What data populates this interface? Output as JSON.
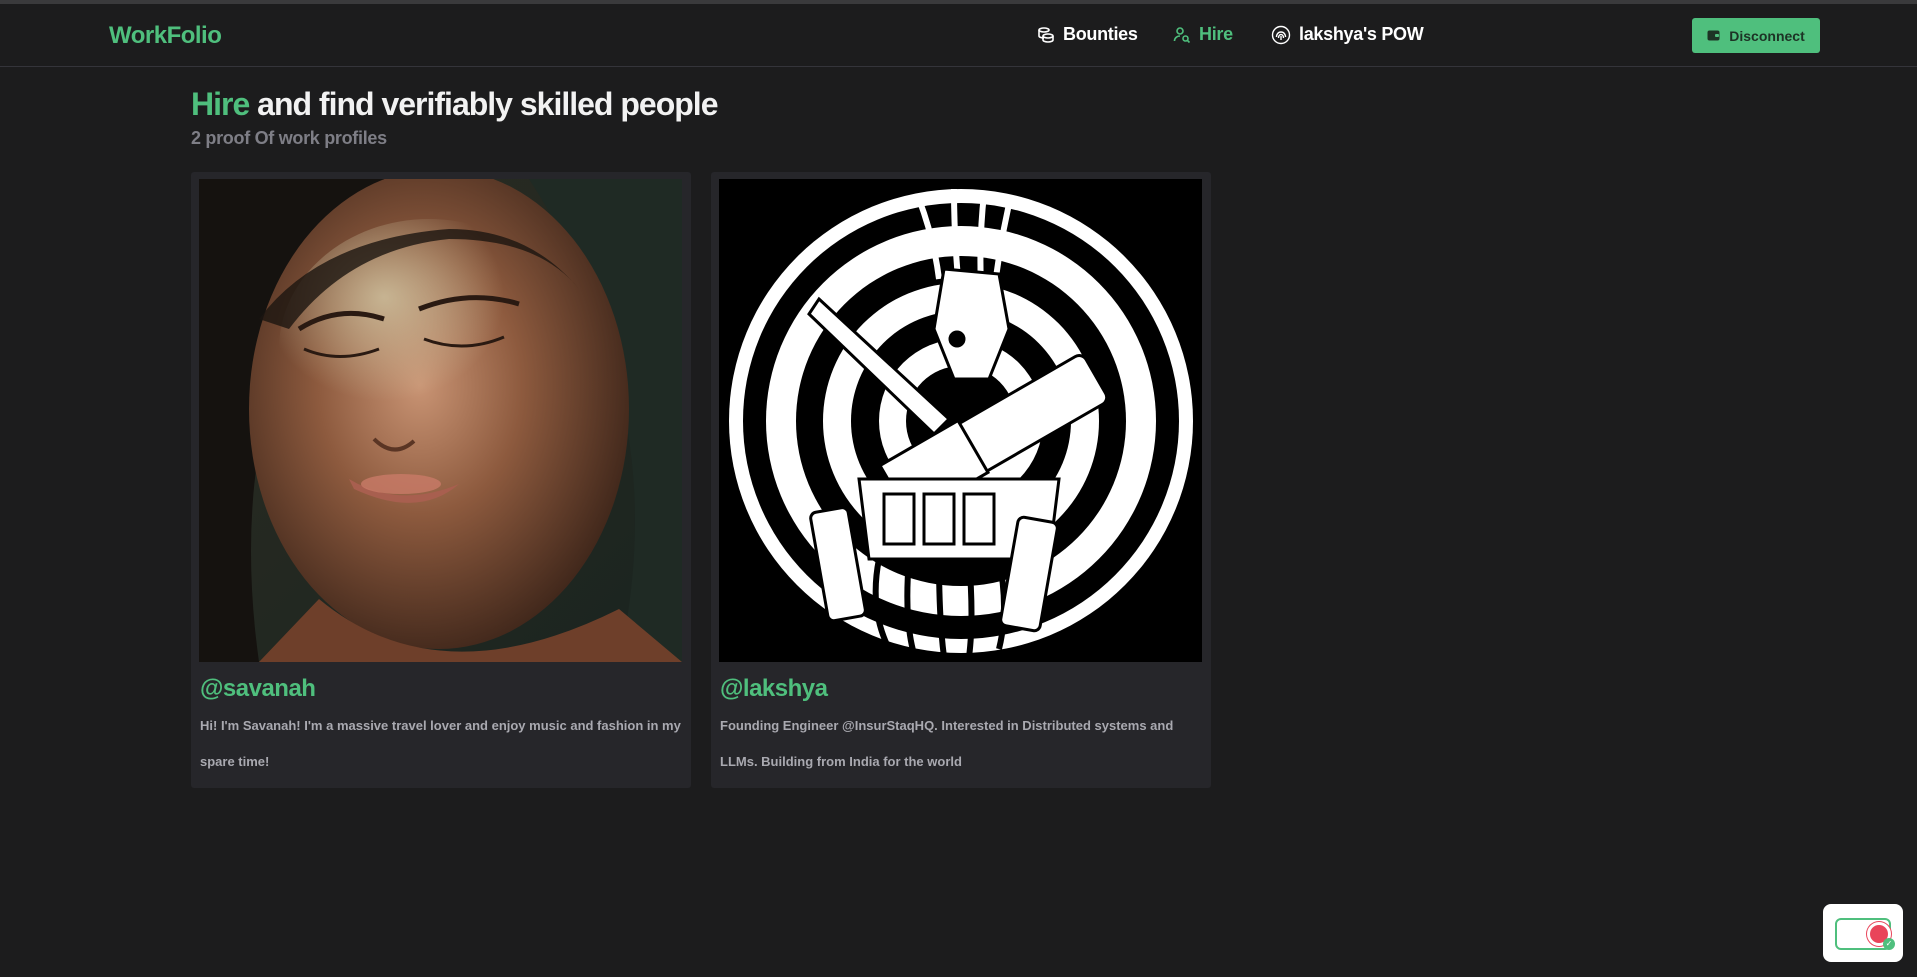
{
  "app": {
    "logo": "WorkFolio"
  },
  "nav": {
    "bounties": "Bounties",
    "hire": "Hire",
    "pow": "lakshya's POW",
    "disconnect": "Disconnect"
  },
  "page": {
    "heading_accent": "Hire",
    "heading_rest": " and find verifiably skilled people",
    "subheading": "2 proof Of work profiles"
  },
  "profiles": [
    {
      "handle": "@savanah",
      "bio": "Hi! I'm Savanah! I'm a massive travel lover and enjoy music and fashion in my spare time!"
    },
    {
      "handle": "@lakshya",
      "bio": "Founding Engineer @InsurStaqHQ. Interested in Distributed systems and LLMs. Building from India for the world"
    }
  ],
  "colors": {
    "accent": "#4fbf7d",
    "background": "#1c1c1d",
    "card": "#26262a"
  }
}
